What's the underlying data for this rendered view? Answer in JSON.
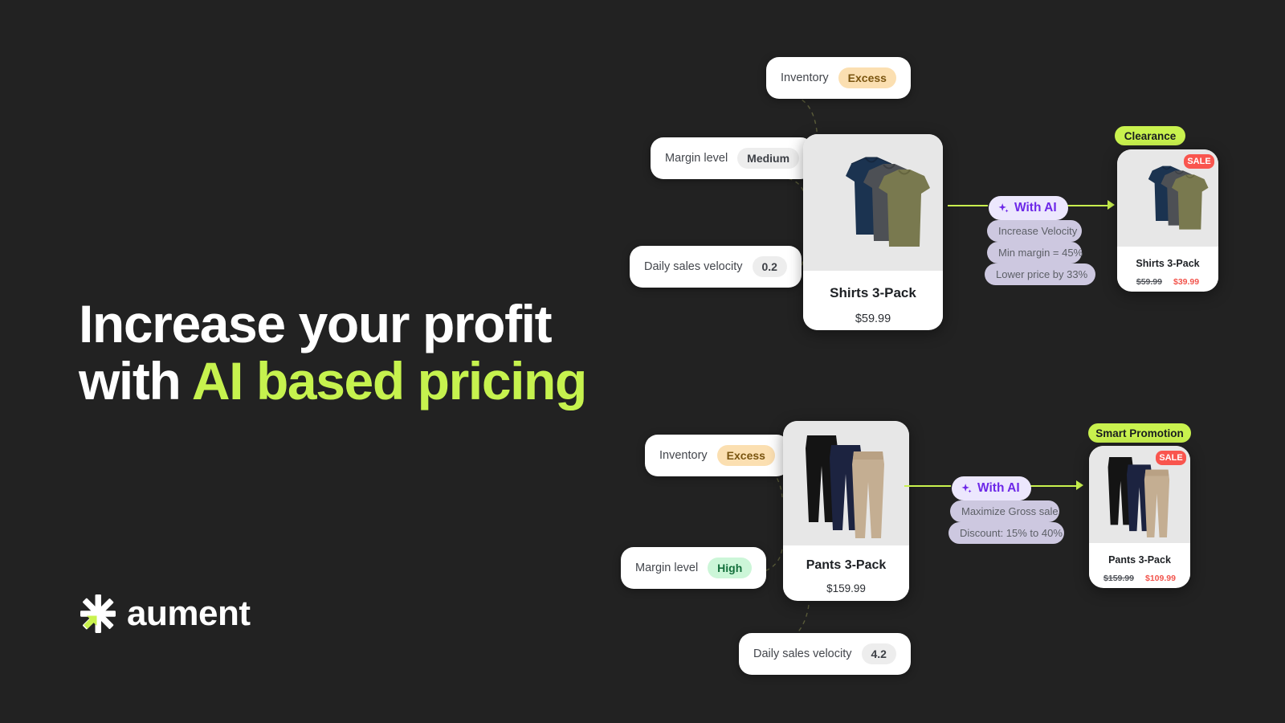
{
  "brand": {
    "name": "aument",
    "logo_icon": "aument-asterisk-logo"
  },
  "headline": {
    "line1": "Increase your profit",
    "line2_plain": "with ",
    "line2_accent": "AI based pricing"
  },
  "colors": {
    "background": "#222222",
    "accent_green": "#c9f24e",
    "ai_purple": "#6d28e8",
    "sale_red": "#f9554e",
    "card_white": "#ffffff"
  },
  "rows": [
    {
      "id": "shirts",
      "attributes": [
        {
          "label": "Inventory",
          "value": "Excess",
          "tone": "excess"
        },
        {
          "label": "Margin level",
          "value": "Medium",
          "tone": "neutral"
        },
        {
          "label": "Daily sales velocity",
          "value": "0.2",
          "tone": "neutral"
        }
      ],
      "product": {
        "title": "Shirts 3-Pack",
        "price": "$59.99"
      },
      "ai": {
        "badge": "With AI",
        "icon": "sparkle-icon",
        "tags": [
          "Increase Velocity",
          "Min margin = 45%",
          "Lower price by 33%"
        ]
      },
      "result": {
        "promo_badge": "Clearance",
        "sale_badge": "SALE",
        "title": "Shirts 3-Pack",
        "old_price": "$59.99",
        "new_price": "$39.99"
      }
    },
    {
      "id": "pants",
      "attributes": [
        {
          "label": "Inventory",
          "value": "Excess",
          "tone": "excess"
        },
        {
          "label": "Margin level",
          "value": "High",
          "tone": "high"
        },
        {
          "label": "Daily sales velocity",
          "value": "4.2",
          "tone": "neutral"
        }
      ],
      "product": {
        "title": "Pants 3-Pack",
        "price": "$159.99"
      },
      "ai": {
        "badge": "With AI",
        "icon": "sparkle-icon",
        "tags": [
          "Maximize Gross sale",
          "Discount: 15% to 40%"
        ]
      },
      "result": {
        "promo_badge": "Smart Promotion",
        "sale_badge": "SALE",
        "title": "Pants 3-Pack",
        "old_price": "$159.99",
        "new_price": "$109.99"
      }
    }
  ]
}
